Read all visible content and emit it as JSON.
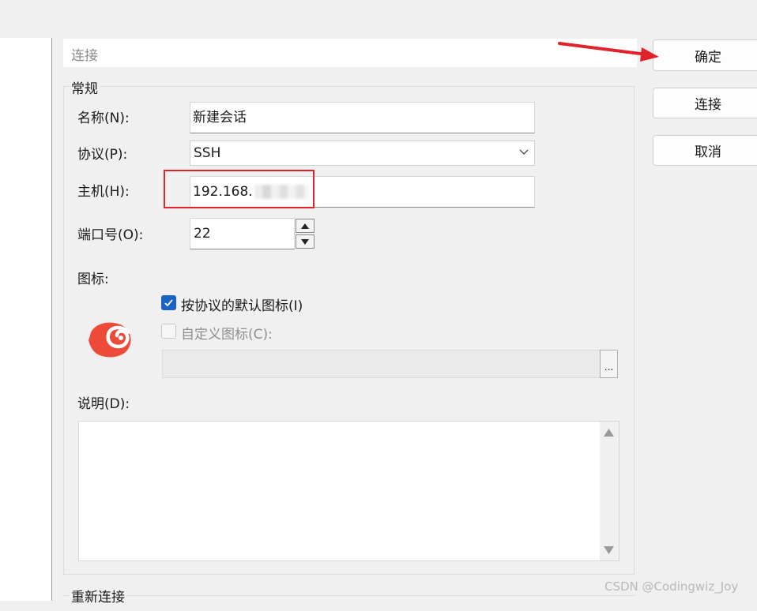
{
  "section": {
    "title": "连接"
  },
  "general": {
    "title": "常规",
    "name_label": "名称(N):",
    "name_value": "新建会话",
    "protocol_label": "协议(P):",
    "protocol_value": "SSH",
    "host_label": "主机(H):",
    "host_value": "192.168.",
    "port_label": "端口号(O):",
    "port_value": "22",
    "icon_label": "图标:",
    "default_icon_label": "按协议的默认图标(I)",
    "default_icon_checked": true,
    "custom_icon_label": "自定义图标(C):",
    "custom_icon_checked": false,
    "browse_label": "...",
    "description_label": "说明(D):",
    "description_value": ""
  },
  "reconnect": {
    "title": "重新连接"
  },
  "buttons": {
    "ok": "确定",
    "connect": "连接",
    "cancel": "取消"
  },
  "icons": {
    "session_icon": "spiral-shell-icon",
    "dropdown": "chevron-down-icon"
  },
  "colors": {
    "highlight": "#e0232a",
    "checkbox_accent": "#1a62c4",
    "session_icon": "#ee4a3a"
  },
  "watermark": "CSDN @Codingwiz_Joy"
}
